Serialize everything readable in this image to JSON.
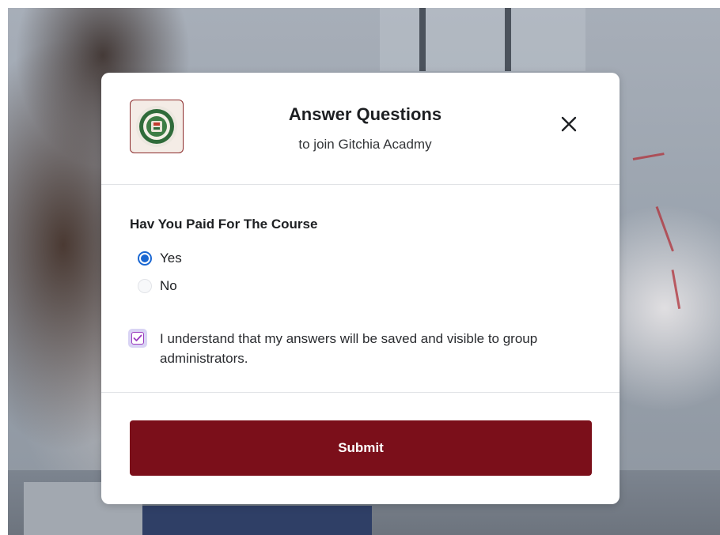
{
  "modal": {
    "title": "Answer Questions",
    "subtitle": "to join Gitchia Acadmy",
    "logo_icon": "academy-emblem-icon",
    "close_icon": "close-icon"
  },
  "form": {
    "question": "Hav You Paid For The Course",
    "options": [
      {
        "label": "Yes",
        "selected": true
      },
      {
        "label": "No",
        "selected": false
      }
    ],
    "consent": {
      "text": "I understand that my answers will be saved and visible to group administrators.",
      "checked": true
    },
    "submit_label": "Submit"
  },
  "colors": {
    "accent": "#7b0f1a",
    "radio_selected": "#1a67d2",
    "checkbox": "#9b3bbf"
  }
}
